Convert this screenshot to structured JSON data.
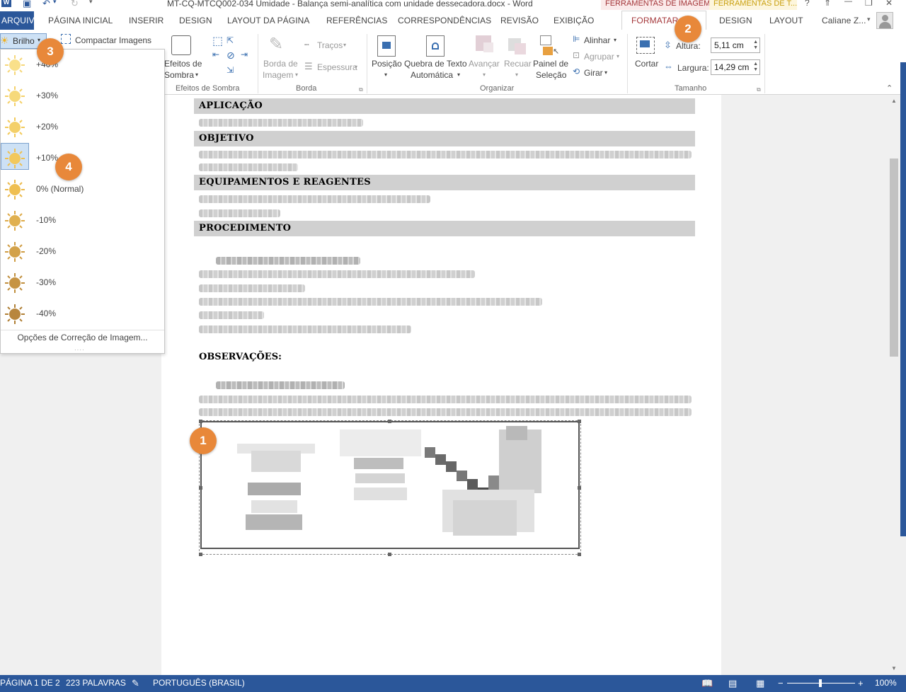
{
  "title_bar": {
    "doc_title": "MT-CQ-MTCQ002-034 Umidade - Balança semi-analítica com unidade dessecadora.docx - Word",
    "context_image_tools": "FERRAMENTAS DE IMAGEM",
    "context_table_tools": "FERRAMENTAS DE T...",
    "help": "?",
    "ribbon_display": "⇑",
    "minimize": "—",
    "restore": "❐",
    "close": "✕"
  },
  "tabs": [
    "ARQUIVO",
    "PÁGINA INICIAL",
    "INSERIR",
    "DESIGN",
    "LAYOUT DA PÁGINA",
    "REFERÊNCIAS",
    "CORRESPONDÊNCIAS",
    "REVISÃO",
    "EXIBIÇÃO",
    "FORMATAR",
    "DESIGN",
    "LAYOUT"
  ],
  "user": "Caliane Z...",
  "ribbon": {
    "brilho": "Brilho",
    "compactar": "Compactar Imagens",
    "efeitos_sombra_1": "Efeitos de",
    "efeitos_sombra_2": "Sombra",
    "grp_efeitos_sombra": "Efeitos de Sombra",
    "borda_imagem_1": "Borda de",
    "borda_imagem_2": "Imagem",
    "tracos": "Traços",
    "espessura": "Espessura",
    "grp_borda": "Borda",
    "posicao": "Posição",
    "quebra_1": "Quebra de Texto",
    "quebra_2": "Automática",
    "avancar": "Avançar",
    "recuar": "Recuar",
    "painel_1": "Painel de",
    "painel_2": "Seleção",
    "alinhar": "Alinhar",
    "agrupar": "Agrupar",
    "girar": "Girar",
    "grp_organizar": "Organizar",
    "cortar": "Cortar",
    "altura_label": "Altura:",
    "altura_value": "5,11 cm",
    "largura_label": "Largura:",
    "largura_value": "14,29 cm",
    "grp_tamanho": "Tamanho"
  },
  "brightness_menu": {
    "items": [
      "+40%",
      "+30%",
      "+20%",
      "+10%",
      "0% (Normal)",
      "-10%",
      "-20%",
      "-30%",
      "-40%"
    ],
    "selected_index": 3,
    "footer": "Opções de Correção de Imagem..."
  },
  "document": {
    "sections": [
      "APLICAÇÃO",
      "OBJETIVO",
      "EQUIPAMENTOS E REAGENTES",
      "PROCEDIMENTO"
    ],
    "observacoes": "OBSERVAÇÕES:"
  },
  "callouts": [
    "1",
    "2",
    "3",
    "4"
  ],
  "status_bar": {
    "page": "PÁGINA 1 DE 2",
    "words": "223 PALAVRAS",
    "language": "PORTUGUÊS (BRASIL)",
    "zoom": "100%"
  },
  "colors": {
    "accent_context": "#a4373a",
    "table_context": "#c9a010",
    "status_bar": "#2b579a",
    "file_tab": "#2b579a",
    "callout": "#e8883a"
  }
}
